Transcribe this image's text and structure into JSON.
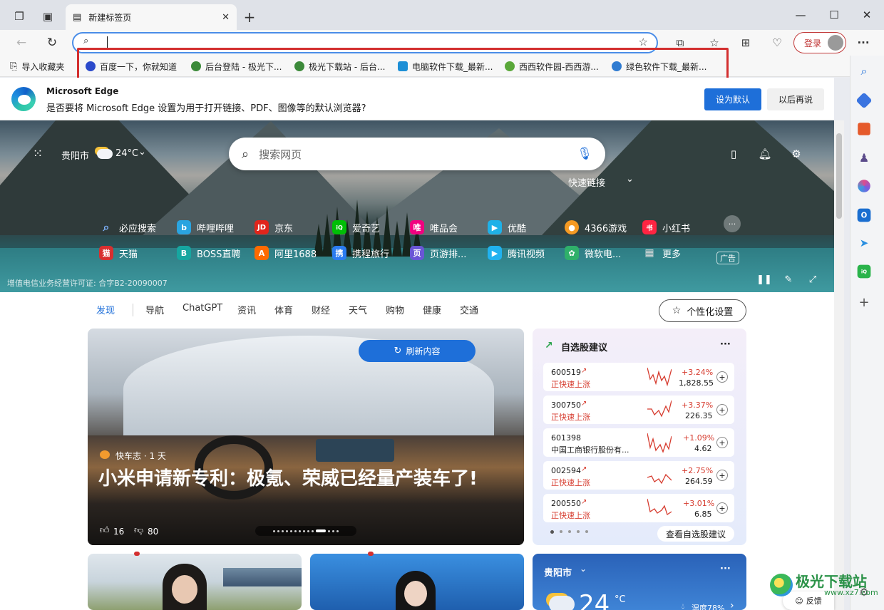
{
  "tab": {
    "title": "新建标签页"
  },
  "window": {
    "minimize": "—",
    "maximize": "☐",
    "close": "✕"
  },
  "toolbar": {
    "login": "登录",
    "more": "···"
  },
  "bookmarks": {
    "import": "导入收藏夹",
    "items": [
      {
        "label": "百度一下，你就知道",
        "color": "#2b4acb"
      },
      {
        "label": "后台登陆 - 极光下...",
        "color": "#3c8a3a"
      },
      {
        "label": "极光下载站 - 后台...",
        "color": "#3c8a3a"
      },
      {
        "label": "电脑软件下载_最新...",
        "color": "#1d8fd6"
      },
      {
        "label": "西西软件园-西西游...",
        "color": "#5aa83a"
      },
      {
        "label": "绿色软件下载_最新...",
        "color": "#2f7bd1"
      }
    ]
  },
  "infobar": {
    "title": "Microsoft Edge",
    "message": "是否要将 Microsoft Edge 设置为用于打开链接、PDF、图像等的默认浏览器?",
    "primary": "设为默认",
    "secondary": "以后再说"
  },
  "hero": {
    "city": "贵阳市",
    "temp": "24°C",
    "search_placeholder": "搜索网页",
    "quick_links_label": "快速链接",
    "license": "增值电信业务经营许可证: 合字B2-20090007",
    "ad": "广告",
    "links_row1": [
      {
        "label": "必应搜索",
        "glyph": "🔍︎",
        "color": "#1e6fd9"
      },
      {
        "label": "哔哩哔哩",
        "glyph": "b",
        "color": "#2aa4e0"
      },
      {
        "label": "京东",
        "glyph": "JD",
        "color": "#e1251b"
      },
      {
        "label": "爱奇艺",
        "glyph": "iQ",
        "color": "#00be06"
      },
      {
        "label": "唯品会",
        "glyph": "唯",
        "color": "#f10180"
      },
      {
        "label": "优酷",
        "glyph": "▶",
        "color": "#1fb1e8"
      },
      {
        "label": "4366游戏",
        "glyph": "●",
        "color": "#f59a23"
      },
      {
        "label": "小红书",
        "glyph": "书",
        "color": "#ff2442"
      }
    ],
    "links_row2": [
      {
        "label": "天猫",
        "glyph": "猫",
        "color": "#d82f2f"
      },
      {
        "label": "BOSS直聘",
        "glyph": "B",
        "color": "#16a6a0"
      },
      {
        "label": "阿里1688",
        "glyph": "A",
        "color": "#ff6a00"
      },
      {
        "label": "携程旅行",
        "glyph": "携",
        "color": "#2b7cf0"
      },
      {
        "label": "页游排...",
        "glyph": "页",
        "color": "#6a56d6"
      },
      {
        "label": "腾讯视频",
        "glyph": "▶",
        "color": "#20b2f0"
      },
      {
        "label": "微软电...",
        "glyph": "✿",
        "color": "#2fb06a"
      },
      {
        "label": "更多",
        "glyph": "▦",
        "color": "#666666"
      }
    ]
  },
  "feed": {
    "categories": [
      "发现",
      "导航",
      "ChatGPT",
      "资讯",
      "体育",
      "财经",
      "天气",
      "购物",
      "健康",
      "交通"
    ],
    "personalize": "个性化设置",
    "main_card": {
      "refresh": "刷新内容",
      "source": "快车志 · 1 天",
      "headline": "小米申请新专利：极氪、荣威已经量产装车了!",
      "likes": "16",
      "dislikes": "80"
    }
  },
  "stocks": {
    "title": "自选股建议",
    "more": "···",
    "items": [
      {
        "code": "600519",
        "name": "正快速上涨",
        "change": "+3.24%",
        "price": "1,828.55"
      },
      {
        "code": "300750",
        "name": "正快速上涨",
        "change": "+3.37%",
        "price": "226.35"
      },
      {
        "code": "601398",
        "name": "中国工商银行股份有...",
        "change": "+1.09%",
        "price": "4.62"
      },
      {
        "code": "002594",
        "name": "正快速上涨",
        "change": "+2.75%",
        "price": "264.59"
      },
      {
        "code": "200550",
        "name": "正快速上涨",
        "change": "+3.01%",
        "price": "6.85"
      }
    ],
    "view_all": "查看自选股建议"
  },
  "weather": {
    "city": "贵阳市",
    "temp": "24",
    "unit": "°C",
    "humidity": "湿度78%"
  },
  "feedback": "反馈",
  "watermark": "极光下载站",
  "watermark_url": "www.xz7.com"
}
